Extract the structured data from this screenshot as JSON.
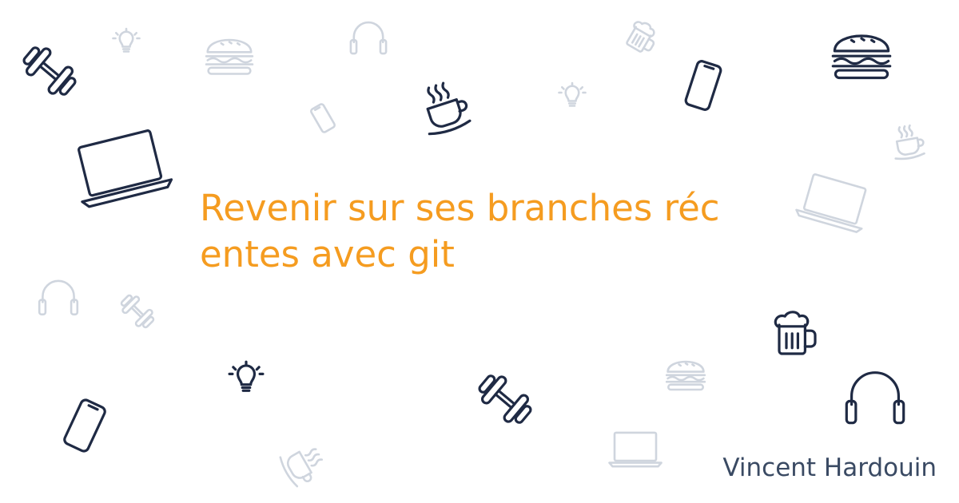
{
  "banner": {
    "title": "Revenir sur ses branches récentes avec git",
    "author": "Vincent Hardouin"
  },
  "colors": {
    "background": "#ffffff",
    "title": "#f59c20",
    "author": "#3a4a63",
    "icon_dark": "#1f2a44",
    "icon_light": "#cfd5de"
  },
  "icons": [
    "dumbbell-icon",
    "lightbulb-icon",
    "burger-icon",
    "headphones-icon",
    "beer-mug-icon",
    "smartphone-icon",
    "coffee-cup-icon",
    "laptop-icon"
  ]
}
